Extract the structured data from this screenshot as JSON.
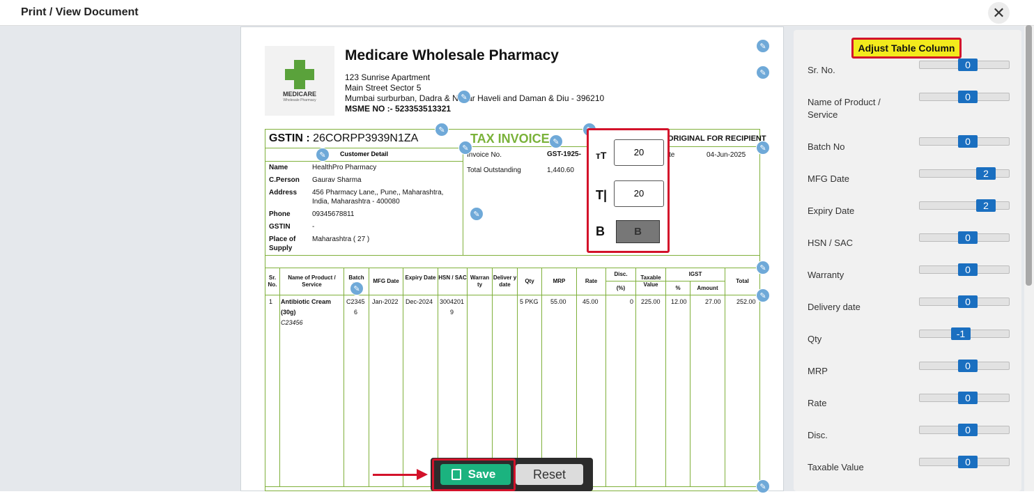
{
  "header": {
    "title": "Print / View Document",
    "close_label": "✕"
  },
  "company": {
    "logo_name": "MEDICARE",
    "logo_sub": "Wholesale Pharmacy",
    "name": "Medicare Wholesale Pharmacy",
    "address1": "123 Sunrise Apartment",
    "address2": "Main Street Sector 5",
    "address3": "Mumbai surburban, Dadra & Nagar Haveli and Daman & Diu - 396210",
    "msme": "MSME NO :- 523353513321"
  },
  "invoice": {
    "gstin_label": "GSTIN :",
    "gstin_value": "26CORPP3939N1ZA",
    "title": "TAX INVOICE",
    "copy": "ORIGINAL FOR RECIPIENT",
    "customer_title": "Customer Detail",
    "name_label": "Name",
    "name": "HealthPro Pharmacy",
    "cperson_label": "C.Person",
    "cperson": "Gaurav Sharma",
    "address_label": "Address",
    "address1": "456 Pharmacy Lane,, Pune,, Maharashtra,",
    "address2": "India, Maharashtra - 400080",
    "phone_label": "Phone",
    "phone": "09345678811",
    "gstin2_label": "GSTIN",
    "gstin2": "-",
    "pos_label1": "Place of",
    "pos_label2": "Supply",
    "pos": "Maharashtra ( 27 )",
    "invoice_no_label": "Invoice No.",
    "invoice_no": "GST-1925-",
    "outstanding_label": "Total Outstanding",
    "outstanding": "1,440.60",
    "date_label": "te",
    "date": "04-Jun-2025"
  },
  "table": {
    "headers": {
      "sr": "Sr. No.",
      "name": "Name of Product / Service",
      "batch": "Batch No",
      "mfg": "MFG Date",
      "expiry": "Expiry Date",
      "hsn": "HSN / SAC",
      "warranty": "Warran ty",
      "delivery": "Deliver y date",
      "qty": "Qty",
      "mrp": "MRP",
      "rate": "Rate",
      "disc": "Disc.",
      "disc_pct": "(%)",
      "taxable": "Taxable Value",
      "igst": "IGST",
      "igst_pct": "%",
      "igst_amt": "Amount",
      "total": "Total"
    },
    "row": {
      "sr": "1",
      "name1": "Antibiotic Cream",
      "name2": "(30g)",
      "code": "C23456",
      "batch1": "C2345",
      "batch2": "6",
      "mfg": "Jan-2022",
      "expiry": "Dec-2024",
      "hsn1": "3004201",
      "hsn2": "9",
      "qty": "5 PKG",
      "mrp": "55.00",
      "rate": "45.00",
      "disc": "0",
      "taxable": "225.00",
      "igst_pct": "12.00",
      "igst_amt": "27.00",
      "total": "252.00"
    }
  },
  "popup": {
    "size1": "20",
    "size2": "20",
    "bold": "B",
    "icon1": "ᴛT",
    "icon2": "T|",
    "icon3": "B"
  },
  "actions": {
    "save": "Save",
    "reset": "Reset"
  },
  "panel": {
    "title": "Adjust Table Column",
    "rows": [
      {
        "label": "Sr. No.",
        "value": "0"
      },
      {
        "label": "Name of Product / Service",
        "value": "0"
      },
      {
        "label": "Batch No",
        "value": "0"
      },
      {
        "label": "MFG Date",
        "value": "2"
      },
      {
        "label": "Expiry Date",
        "value": "2"
      },
      {
        "label": "HSN / SAC",
        "value": "0"
      },
      {
        "label": "Warranty",
        "value": "0"
      },
      {
        "label": "Delivery date",
        "value": "0"
      },
      {
        "label": "Qty",
        "value": "-1"
      },
      {
        "label": "MRP",
        "value": "0"
      },
      {
        "label": "Rate",
        "value": "0"
      },
      {
        "label": "Disc.",
        "value": "0"
      },
      {
        "label": "Taxable Value",
        "value": "0"
      }
    ]
  }
}
